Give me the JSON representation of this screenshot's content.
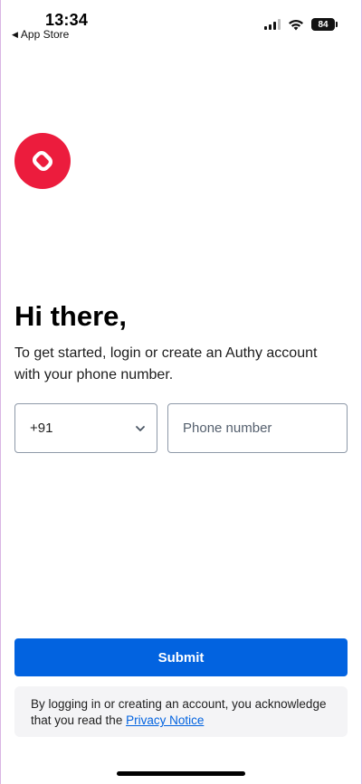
{
  "status_bar": {
    "time": "13:34",
    "back_app": "App Store",
    "battery": "84",
    "icons": [
      "cellular-signal-icon",
      "wifi-icon",
      "battery-icon"
    ]
  },
  "logo": {
    "icon": "authy-logo-icon",
    "color": "#ec1c3d"
  },
  "heading": "Hi there,",
  "subtext": "To get started, login or create an Authy account with your phone number.",
  "country_code": {
    "value": "+91",
    "icon": "chevron-down-icon"
  },
  "phone_input": {
    "placeholder": "Phone number",
    "value": ""
  },
  "submit": {
    "label": "Submit",
    "color": "#0263e0"
  },
  "notice": {
    "text": "By logging in or creating an account, you acknowledge that you read the ",
    "link_text": "Privacy Notice"
  }
}
